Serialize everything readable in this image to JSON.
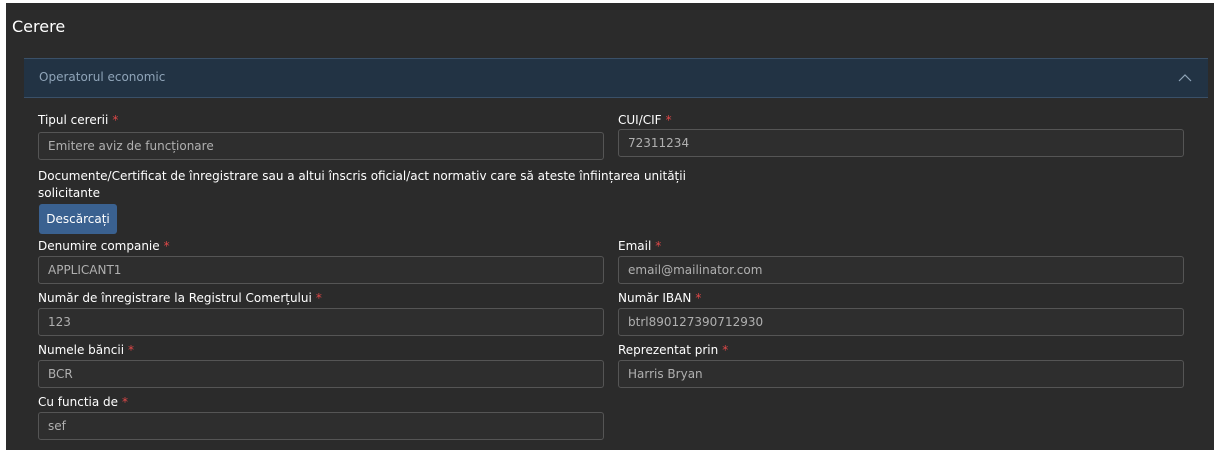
{
  "page": {
    "title": "Cerere"
  },
  "section": {
    "title": "Operatorul economic",
    "expanded": true
  },
  "fields": {
    "tipul_cererii": {
      "label": "Tipul cererii",
      "required": "*",
      "value": "Emitere aviz de funcționare"
    },
    "cui_cif": {
      "label": "CUI/CIF",
      "required": "*",
      "value": "72311234"
    },
    "documente": {
      "text": "Documente/Certificat de înregistrare sau a altui înscris oficial/act normativ care să ateste înființarea unității solicitante"
    },
    "denumire_companie": {
      "label": "Denumire companie",
      "required": "*",
      "value": "APPLICANT1"
    },
    "email": {
      "label": "Email",
      "required": "*",
      "value": "email@mailinator.com"
    },
    "numar_registru": {
      "label": "Număr de înregistrare la Registrul Comerțului",
      "required": "*",
      "value": "123"
    },
    "numar_iban": {
      "label": "Număr IBAN",
      "required": "*",
      "value": "btrl890127390712930"
    },
    "numele_bancii": {
      "label": "Numele băncii",
      "required": "*",
      "value": "BCR"
    },
    "reprezentat_prin": {
      "label": "Reprezentat prin",
      "required": "*",
      "value": "Harris Bryan"
    },
    "cu_functia": {
      "label": "Cu functia de",
      "required": "*",
      "value": "sef"
    }
  },
  "buttons": {
    "download_label": "Descărcați"
  },
  "colors": {
    "background": "#2b2b2b",
    "section_header": "#223344",
    "required_marker": "#e04848",
    "button": "#3a6190"
  },
  "icons": {
    "collapse": "chevron-up-icon"
  }
}
